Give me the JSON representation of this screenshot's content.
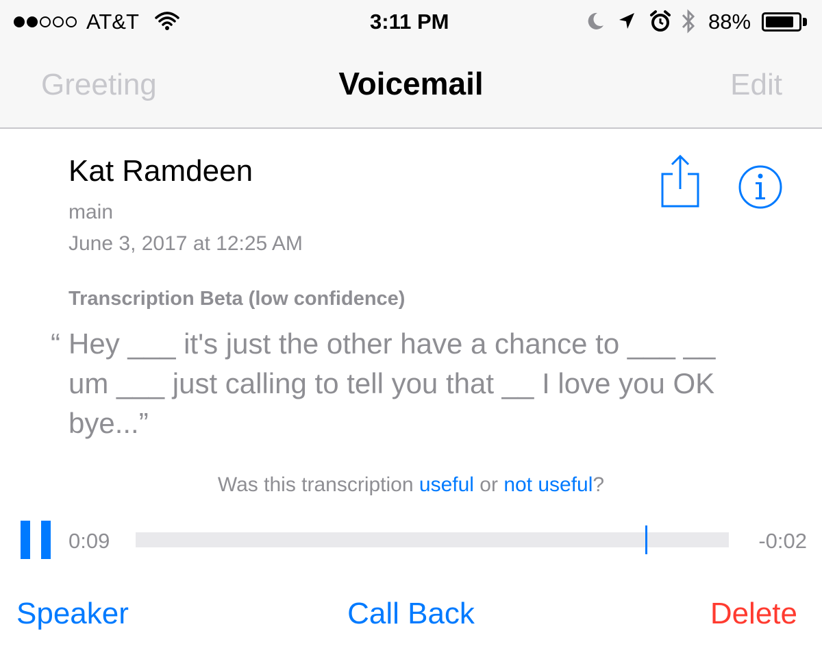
{
  "status_bar": {
    "signal_strength": "2 of 5",
    "carrier": "AT&T",
    "time": "3:11 PM",
    "battery_percent": "88%",
    "battery_level": 0.88,
    "icons": [
      "wifi-icon",
      "moon-icon",
      "location-icon",
      "alarm-icon",
      "bluetooth-icon",
      "battery-icon"
    ]
  },
  "nav": {
    "left": "Greeting",
    "title": "Voicemail",
    "right": "Edit"
  },
  "voicemail": {
    "caller": "Kat Ramdeen",
    "label": "main",
    "datetime": "June 3, 2017 at 12:25 AM"
  },
  "transcription": {
    "heading": "Transcription Beta (low confidence)",
    "open_quote": "“",
    "text": "Hey ___ it's just the other have a chance to ___ __ um ___ just calling to tell you that __ I love you OK bye...”",
    "feedback_prefix": "Was this transcription ",
    "useful": "useful",
    "or": " or ",
    "not_useful": "not useful",
    "feedback_suffix": "?"
  },
  "player": {
    "elapsed": "0:09",
    "remaining": "-0:02",
    "progress": 0.86
  },
  "actions": {
    "speaker": "Speaker",
    "call_back": "Call Back",
    "delete": "Delete"
  },
  "colors": {
    "accent": "#007aff",
    "destructive": "#ff3b30",
    "secondary_text": "#8e8e93",
    "disabled_text": "#c7c7cc"
  }
}
